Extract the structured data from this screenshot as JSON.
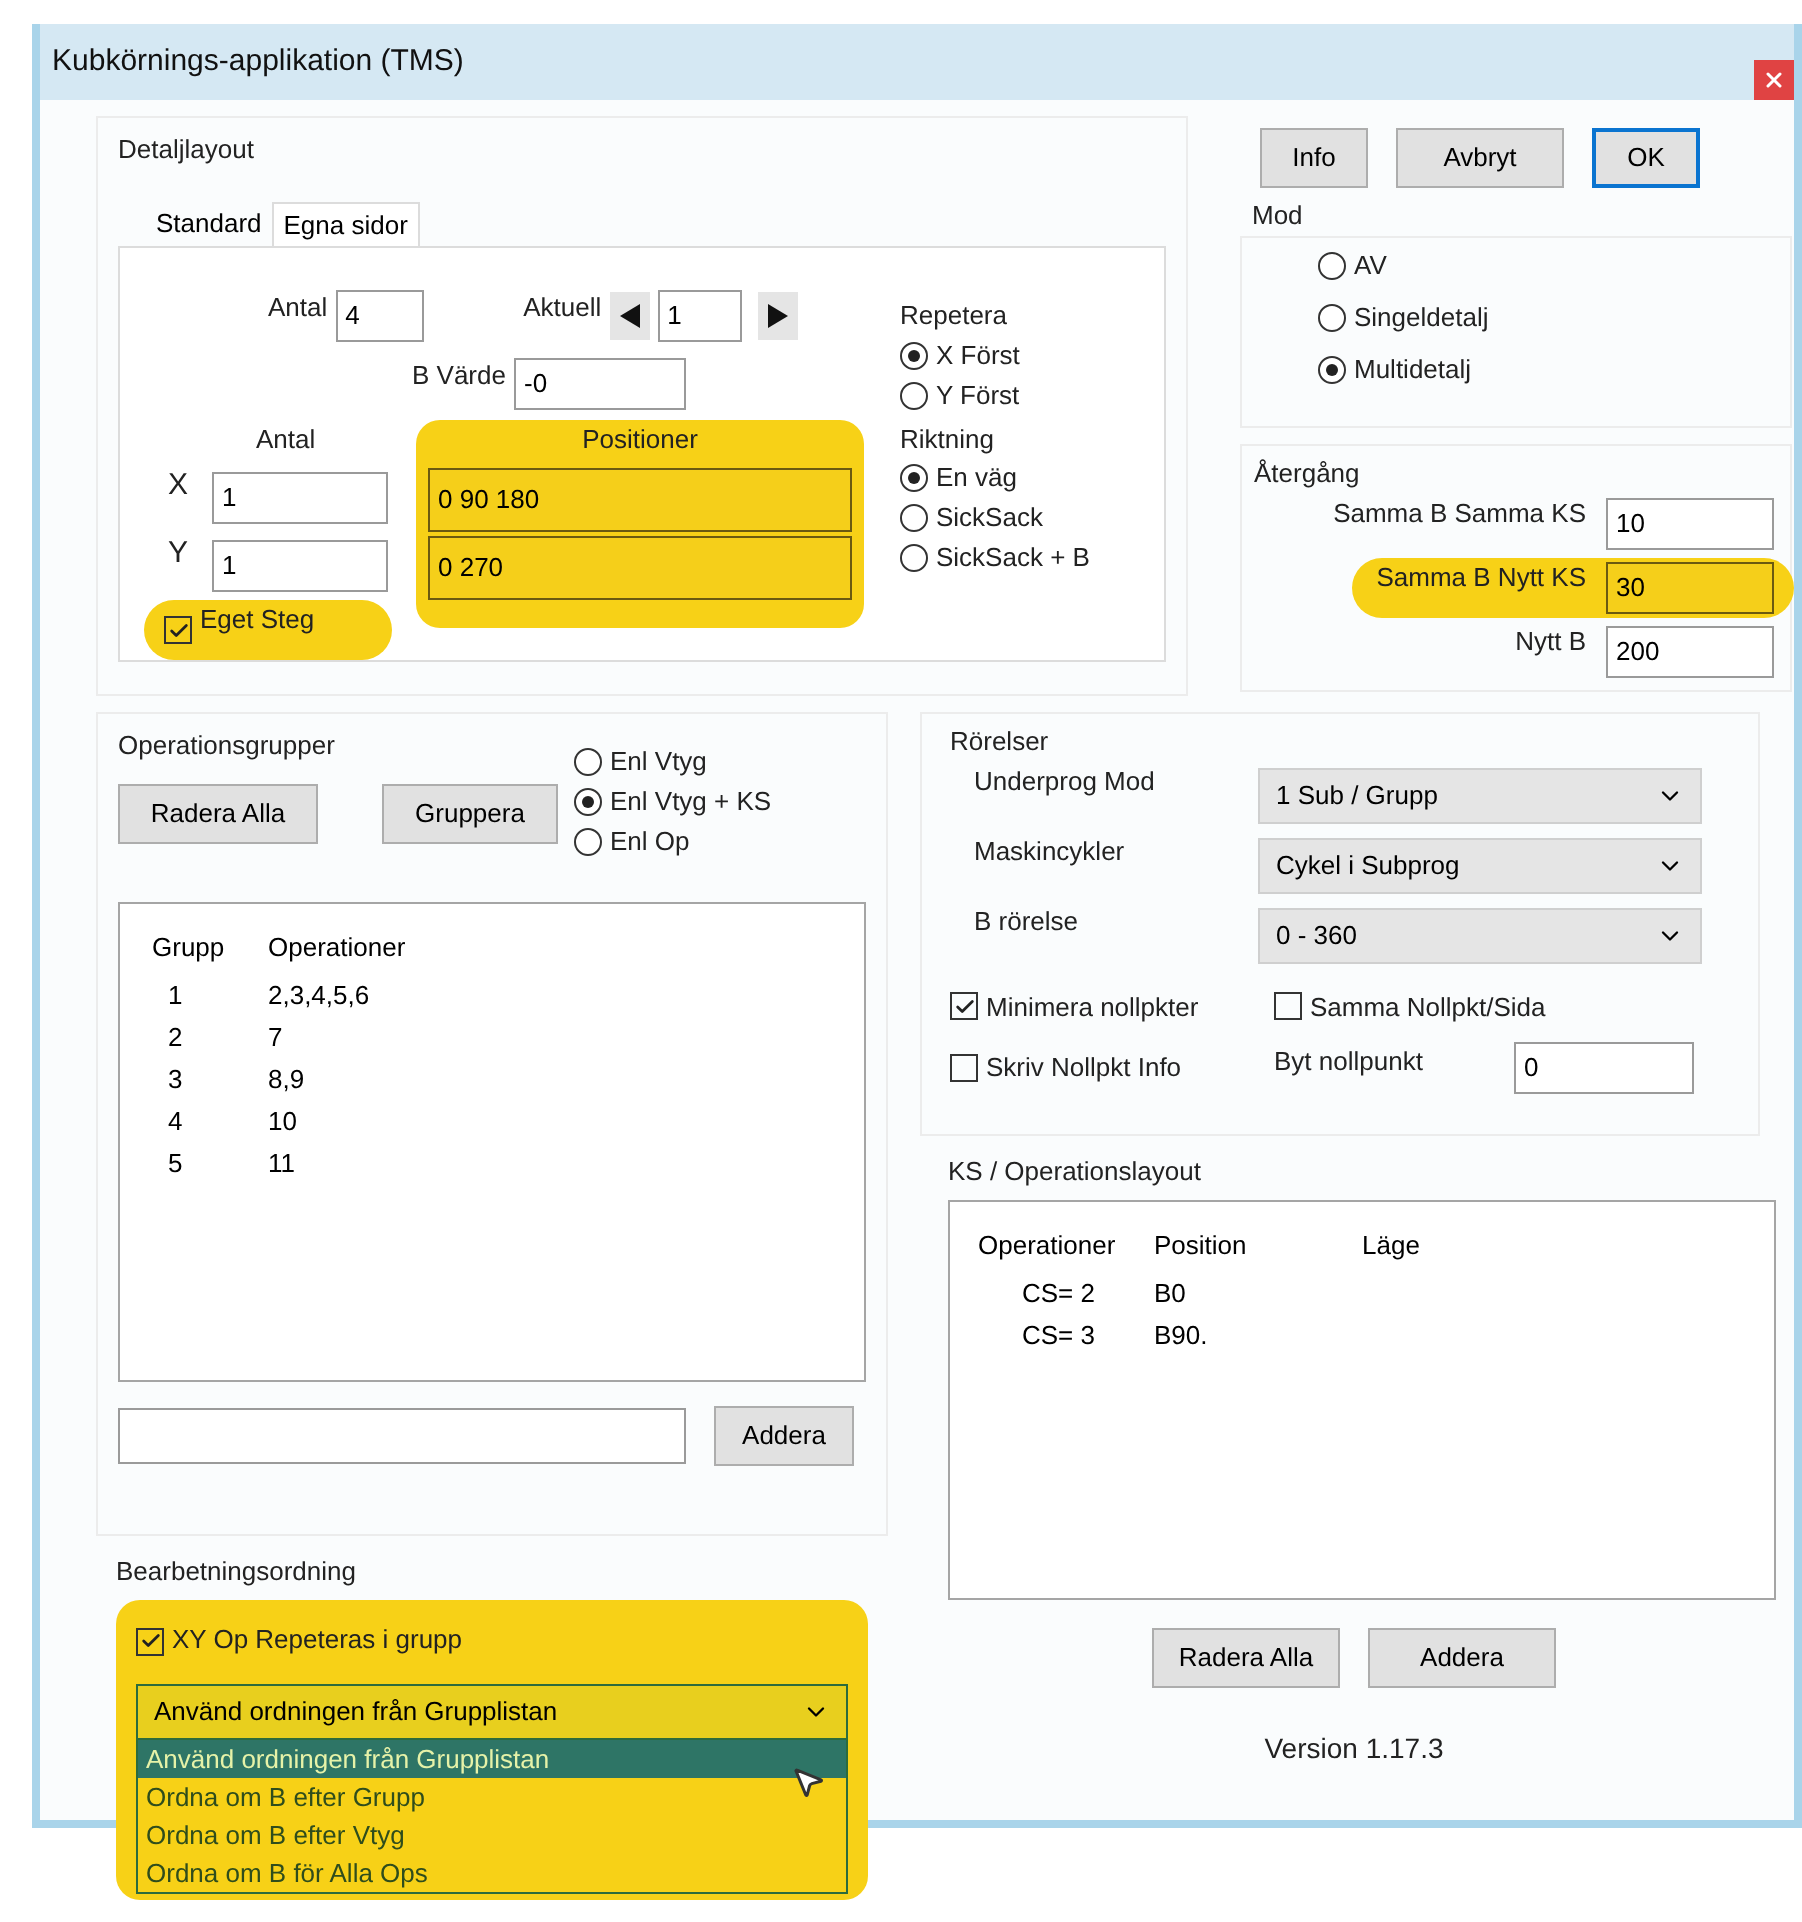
{
  "window": {
    "title": "Kubkörnings-applikation (TMS)"
  },
  "detail_layout": {
    "title": "Detaljlayout",
    "tabs": [
      {
        "label": "Standard",
        "selected": false
      },
      {
        "label": "Egna sidor",
        "selected": true
      }
    ],
    "count": {
      "label": "Antal",
      "value": "4"
    },
    "current": {
      "label": "Aktuell",
      "value": "1"
    },
    "b_value": {
      "label": "B Värde",
      "value": "-0"
    },
    "grid": {
      "count_header": "Antal",
      "positions_header": "Positioner",
      "highlighted": true,
      "rows": [
        {
          "axis": "X",
          "count": "1",
          "positions": "0 90 180"
        },
        {
          "axis": "Y",
          "count": "1",
          "positions": "0 270"
        }
      ]
    },
    "own_step": {
      "label": "Eget Steg",
      "checked": true,
      "highlighted": true
    },
    "repeat": {
      "title": "Repetera",
      "options": [
        {
          "label": "X Först",
          "selected": true
        },
        {
          "label": "Y Först",
          "selected": false
        }
      ]
    },
    "direction": {
      "title": "Riktning",
      "options": [
        {
          "label": "En väg",
          "selected": true
        },
        {
          "label": "SickSack",
          "selected": false
        },
        {
          "label": "SickSack + B",
          "selected": false
        }
      ]
    }
  },
  "buttons": [
    {
      "label": "Info",
      "default": false
    },
    {
      "label": "Avbryt",
      "default": false
    },
    {
      "label": "OK",
      "default": true
    }
  ],
  "mode": {
    "title": "Mod",
    "options": [
      {
        "label": "AV",
        "selected": false
      },
      {
        "label": "Singeldetalj",
        "selected": false
      },
      {
        "label": "Multidetalj",
        "selected": true
      }
    ]
  },
  "return": {
    "title": "Återgång",
    "fields": [
      {
        "label": "Samma B Samma KS",
        "value": "10",
        "highlighted": false
      },
      {
        "label": "Samma B Nytt KS",
        "value": "30",
        "highlighted": true
      },
      {
        "label": "Nytt B",
        "value": "200",
        "highlighted": false
      }
    ]
  },
  "operation_groups": {
    "title": "Operationsgrupper",
    "buttons": [
      "Radera Alla",
      "Gruppera"
    ],
    "options": [
      {
        "label": "Enl Vtyg",
        "selected": false
      },
      {
        "label": "Enl Vtyg + KS",
        "selected": true
      },
      {
        "label": "Enl Op",
        "selected": false
      }
    ],
    "columns": [
      "Grupp",
      "Operationer"
    ],
    "rows": [
      [
        "1",
        "2,3,4,5,6"
      ],
      [
        "2",
        "7"
      ],
      [
        "3",
        "8,9"
      ],
      [
        "4",
        "10"
      ],
      [
        "5",
        "11"
      ]
    ],
    "add_button": "Addera"
  },
  "processing_order": {
    "title": "Bearbetningsordning",
    "highlighted": true,
    "repeat_checkbox": {
      "label": "XY Op Repeteras i grupp",
      "checked": true
    },
    "select": {
      "value": "Använd ordningen från Grupplistan",
      "expanded": true
    },
    "options": [
      {
        "label": "Använd ordningen från Grupplistan",
        "selected": true
      },
      {
        "label": "Ordna om B efter Grupp",
        "selected": false
      },
      {
        "label": "Ordna om B efter Vtyg",
        "selected": false
      },
      {
        "label": "Ordna om B för Alla Ops",
        "selected": false
      }
    ]
  },
  "movements": {
    "title": "Rörelser",
    "selects": [
      {
        "label": "Underprog Mod",
        "value": "1 Sub / Grupp"
      },
      {
        "label": "Maskincykler",
        "value": "Cykel i Subprog"
      },
      {
        "label": "B rörelse",
        "value": "0 - 360"
      }
    ],
    "checkboxes": [
      {
        "label": "Minimera nollpkter",
        "checked": true
      },
      {
        "label": "Samma Nollpkt/Sida",
        "checked": false
      },
      {
        "label": "Skriv Nollpkt Info",
        "checked": false
      }
    ],
    "zero_point": {
      "label": "Byt nollpunkt",
      "value": "0"
    }
  },
  "ks_layout": {
    "title": "KS / Operationslayout",
    "columns": [
      "Operationer",
      "Position",
      "Läge"
    ],
    "rows": [
      [
        "CS= 2",
        "B0"
      ],
      [
        "CS= 3",
        "B90."
      ]
    ],
    "buttons": [
      "Radera Alla",
      "Addera"
    ]
  },
  "version": "Version 1.17.3"
}
